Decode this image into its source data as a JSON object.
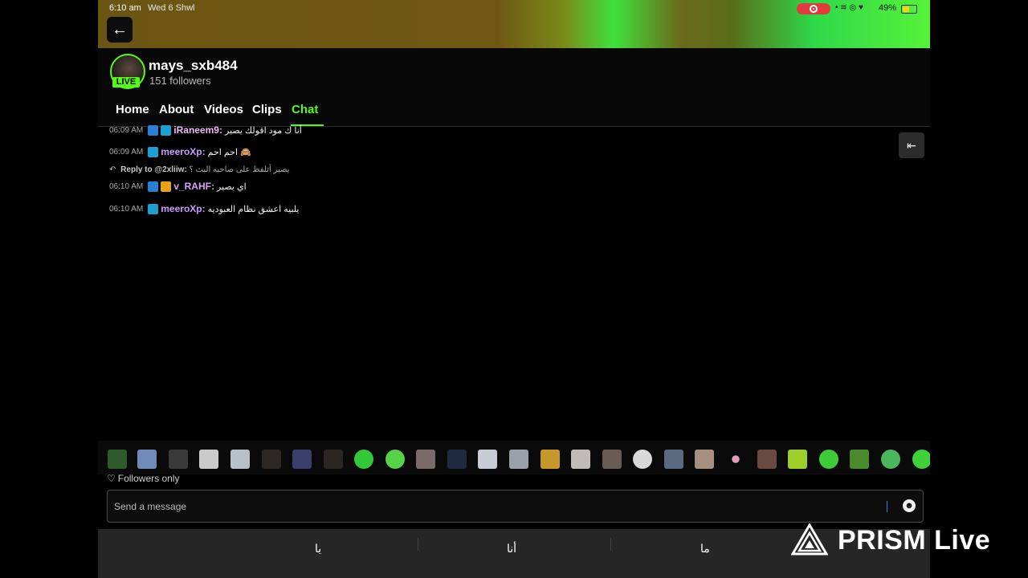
{
  "status_bar": {
    "time": "6:10 am",
    "date": "Wed 6 Shwl",
    "icons": "wifi-location-heart",
    "battery": "49%",
    "battery_fraction": 0.49
  },
  "back_icon": "back-arrow-icon",
  "profile": {
    "username": "mays_sxb484",
    "followers": "151 followers",
    "live_label": "LIVE"
  },
  "tabs": [
    {
      "label": "Home",
      "active": false
    },
    {
      "label": "About",
      "active": false
    },
    {
      "label": "Videos",
      "active": false
    },
    {
      "label": "Clips",
      "active": false
    },
    {
      "label": "Chat",
      "active": true
    }
  ],
  "chat": {
    "messages": [
      {
        "time": "06:09 AM",
        "user": "iRaneem9:",
        "text": "أنا ك مود اقولك يصير",
        "color": "#f0b8f2"
      },
      {
        "time": "06:09 AM",
        "user": "meeroXp:",
        "text": "احم احم 🙈",
        "color": "#c99bff"
      },
      {
        "time": "06:10 AM",
        "user": "v_RAHF:",
        "text": "اي يصير",
        "color": "#d9a3f5"
      },
      {
        "time": "06:10 AM",
        "user": "meeroXp:",
        "text": "يلبيه اعشق نظام العبوديه",
        "color": "#c99bff"
      }
    ],
    "reply": {
      "prefix": "Reply to @2xliiw:",
      "text": "يصير أتلفظ على صاحبه البث ؟"
    }
  },
  "footer": {
    "followers_only": "Followers only",
    "input_placeholder": "Send a message"
  },
  "keyboard": {
    "suggestions": [
      "يا",
      "أنا",
      "ما"
    ]
  },
  "watermark": {
    "text": "PRISM Live"
  },
  "colors": {
    "accent": "#53fc18",
    "background": "#000000"
  }
}
